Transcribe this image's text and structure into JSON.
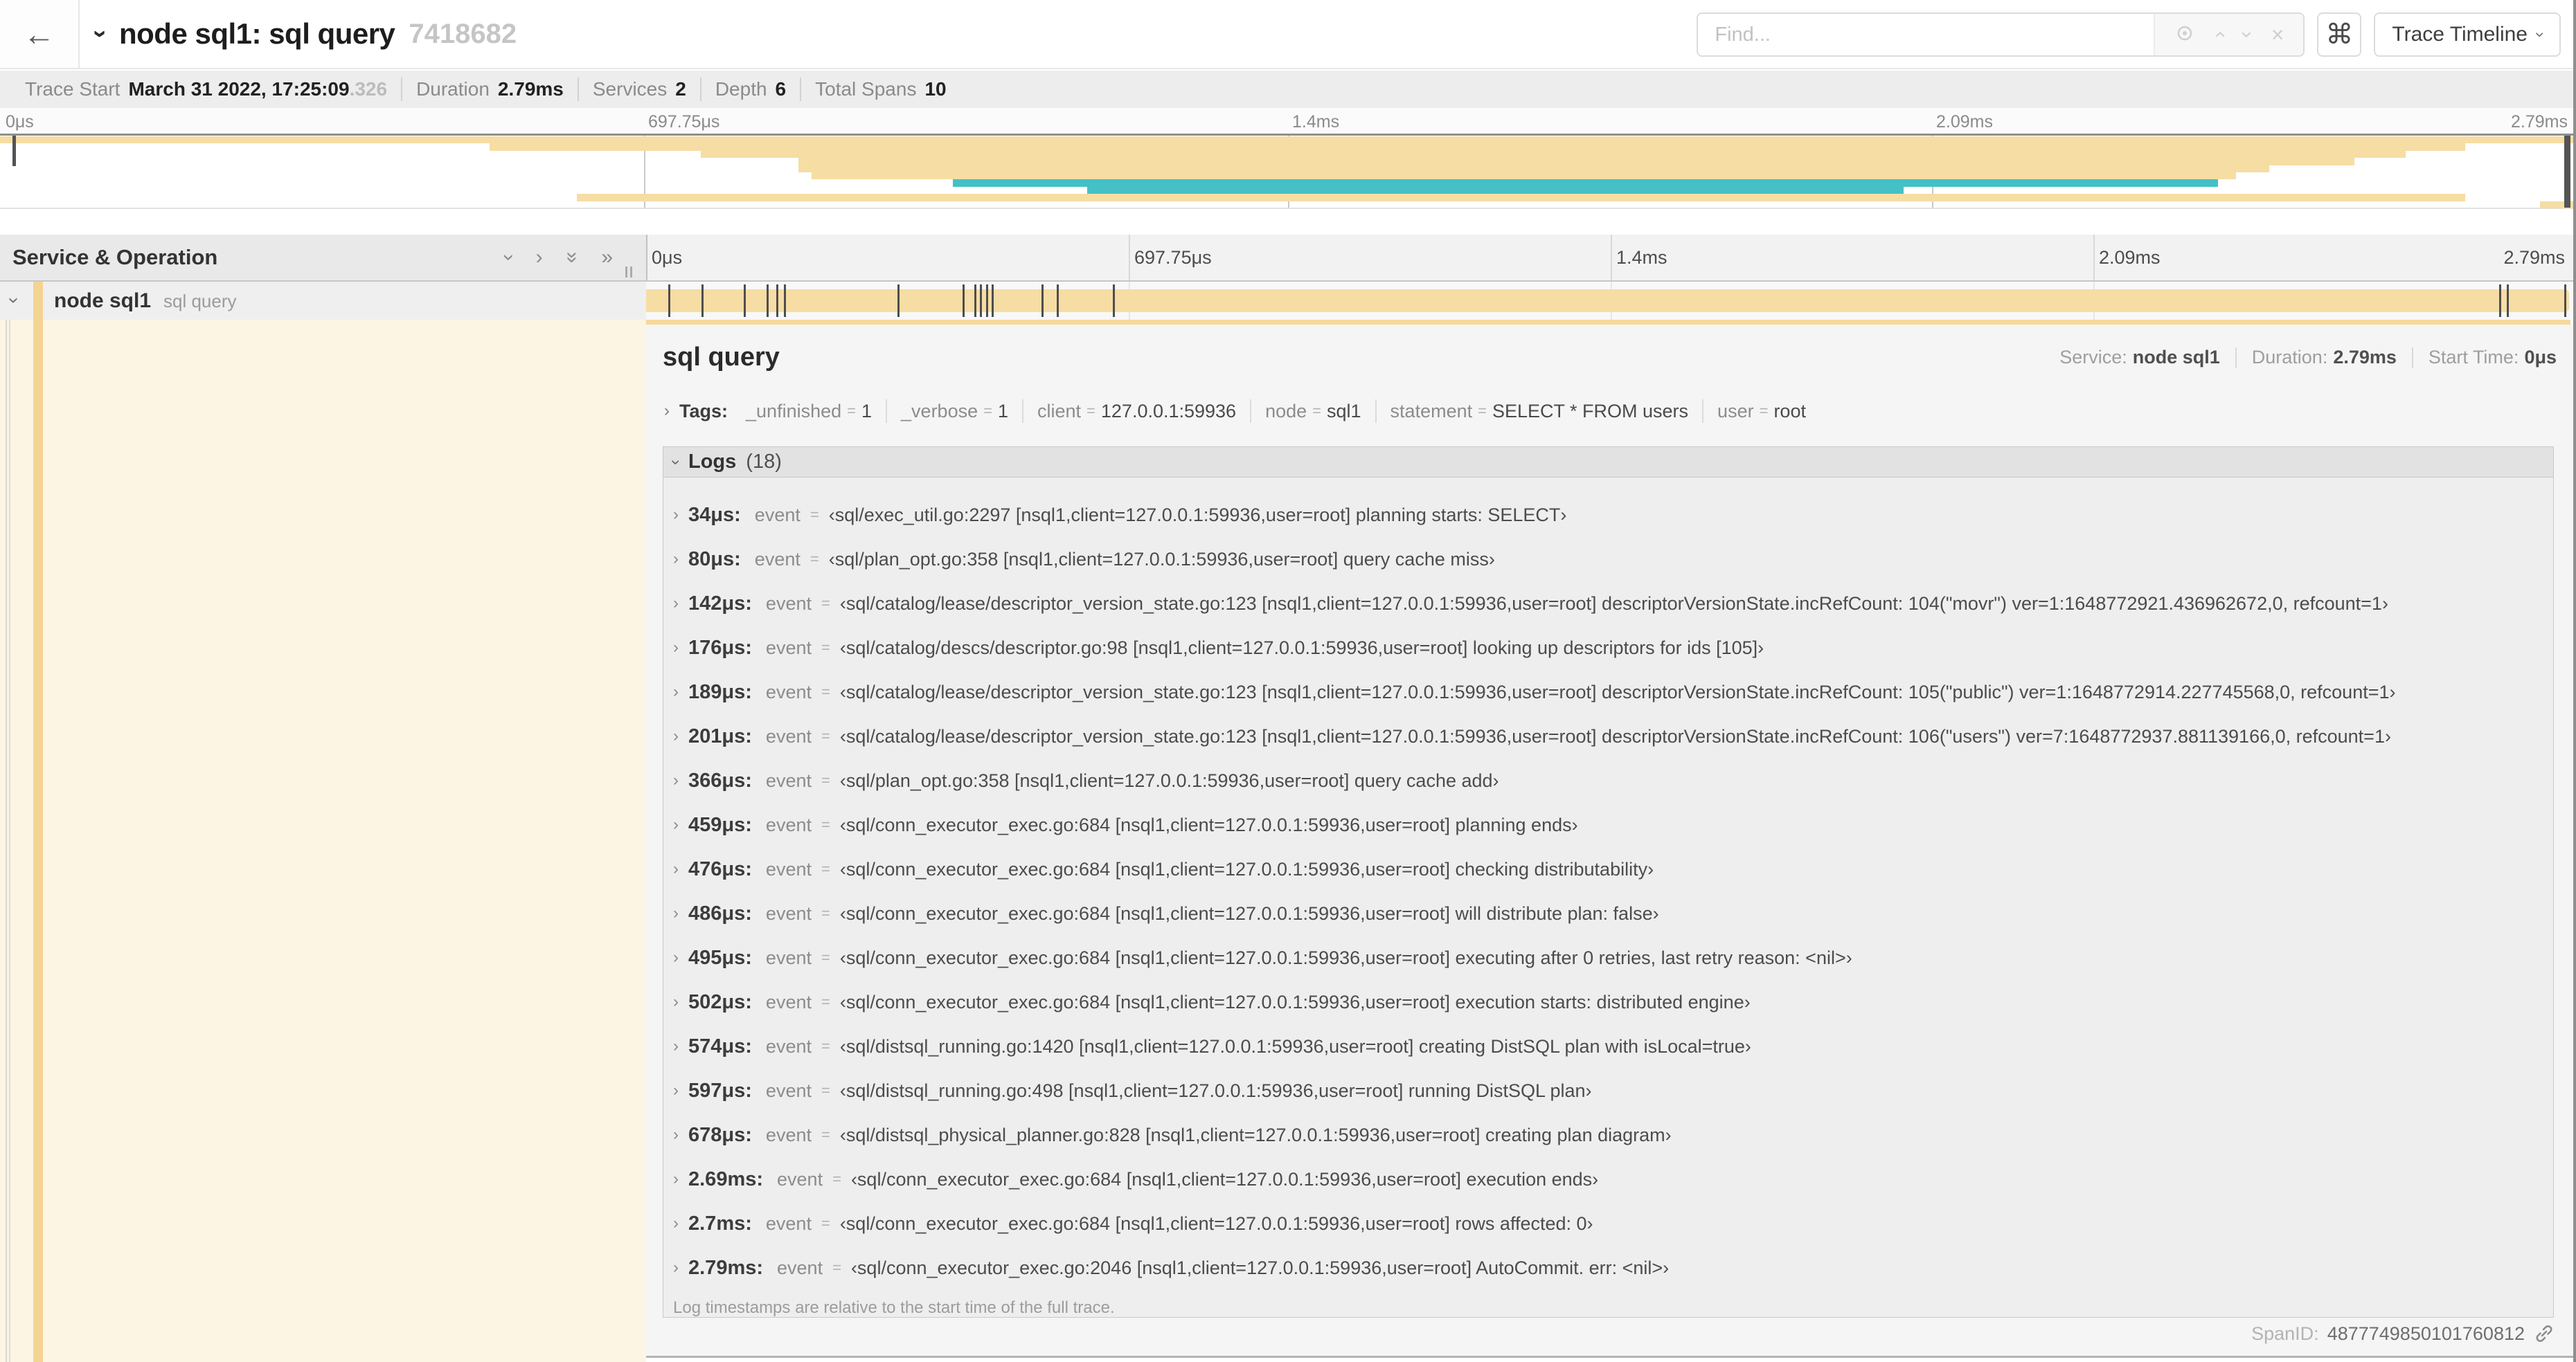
{
  "icons": {
    "back": "←",
    "chevron": "›",
    "double_chevron": "»",
    "command": "⌘",
    "close": "×"
  },
  "header": {
    "title": "node sql1: sql query",
    "trace_id": "7418682",
    "find_placeholder": "Find...",
    "view_dropdown_label": "Trace Timeline"
  },
  "trace_info": {
    "items": [
      {
        "label": "Trace Start",
        "value": "March 31 2022, 17:25:09",
        "suffix": ".326"
      },
      {
        "label": "Duration",
        "value": "2.79ms"
      },
      {
        "label": "Services",
        "value": "2"
      },
      {
        "label": "Depth",
        "value": "6"
      },
      {
        "label": "Total Spans",
        "value": "10"
      }
    ]
  },
  "timeline": {
    "ticks": [
      "0μs",
      "697.75μs",
      "1.4ms",
      "2.09ms",
      "2.79ms"
    ],
    "duration": "2.79ms"
  },
  "columns": {
    "left_header": "Service & Operation"
  },
  "minimap": {
    "spans": [
      {
        "row": 1,
        "start": 0,
        "end": 100,
        "color": "tan"
      },
      {
        "row": 2,
        "start": 19,
        "end": 95.7,
        "color": "tan"
      },
      {
        "row": 3,
        "start": 27.2,
        "end": 93.4,
        "color": "tan"
      },
      {
        "row": 4,
        "start": 31,
        "end": 91.4,
        "color": "tan"
      },
      {
        "row": 5,
        "start": 31,
        "end": 88.1,
        "color": "tan"
      },
      {
        "row": 6,
        "start": 31.5,
        "end": 86.8,
        "color": "tan"
      },
      {
        "row": 7,
        "start": 37,
        "end": 86.1,
        "color": "teal"
      },
      {
        "row": 8,
        "start": 42.2,
        "end": 73.9,
        "color": "teal"
      },
      {
        "row": 9,
        "start": 22.4,
        "end": 95.7,
        "color": "tan"
      },
      {
        "row": 10,
        "start": 98.6,
        "end": 100,
        "color": "tan"
      }
    ]
  },
  "span_row": {
    "service": "node sql1",
    "operation": "sql query",
    "tick_fractions": [
      1.2,
      2.9,
      5.1,
      6.3,
      6.8,
      7.2,
      13.1,
      16.5,
      17.1,
      17.4,
      17.7,
      18,
      20.6,
      21.4,
      24.3,
      96.4,
      96.8,
      99.8
    ]
  },
  "detail": {
    "operation": "sql query",
    "service_label": "Service:",
    "service": "node sql1",
    "duration_label": "Duration:",
    "duration": "2.79ms",
    "start_label": "Start Time:",
    "start": "0μs",
    "tags_label": "Tags:",
    "tags": [
      {
        "key": "_unfinished",
        "value": "1"
      },
      {
        "key": "_verbose",
        "value": "1"
      },
      {
        "key": "client",
        "value": "127.0.0.1:59936"
      },
      {
        "key": "node",
        "value": "sql1"
      },
      {
        "key": "statement",
        "value": "SELECT * FROM users"
      },
      {
        "key": "user",
        "value": "root"
      }
    ],
    "logs": {
      "label": "Logs",
      "count": "(18)",
      "entries": [
        {
          "ts": "34μs:",
          "key": "event",
          "value": "‹sql/exec_util.go:2297 [nsql1,client=127.0.0.1:59936,user=root] planning starts: SELECT›"
        },
        {
          "ts": "80μs:",
          "key": "event",
          "value": "‹sql/plan_opt.go:358 [nsql1,client=127.0.0.1:59936,user=root] query cache miss›"
        },
        {
          "ts": "142μs:",
          "key": "event",
          "value": "‹sql/catalog/lease/descriptor_version_state.go:123 [nsql1,client=127.0.0.1:59936,user=root] descriptorVersionState.incRefCount: 104(\"movr\") ver=1:1648772921.436962672,0, refcount=1›"
        },
        {
          "ts": "176μs:",
          "key": "event",
          "value": "‹sql/catalog/descs/descriptor.go:98 [nsql1,client=127.0.0.1:59936,user=root] looking up descriptors for ids [105]›"
        },
        {
          "ts": "189μs:",
          "key": "event",
          "value": "‹sql/catalog/lease/descriptor_version_state.go:123 [nsql1,client=127.0.0.1:59936,user=root] descriptorVersionState.incRefCount: 105(\"public\") ver=1:1648772914.227745568,0, refcount=1›"
        },
        {
          "ts": "201μs:",
          "key": "event",
          "value": "‹sql/catalog/lease/descriptor_version_state.go:123 [nsql1,client=127.0.0.1:59936,user=root] descriptorVersionState.incRefCount: 106(\"users\") ver=7:1648772937.881139166,0, refcount=1›"
        },
        {
          "ts": "366μs:",
          "key": "event",
          "value": "‹sql/plan_opt.go:358 [nsql1,client=127.0.0.1:59936,user=root] query cache add›"
        },
        {
          "ts": "459μs:",
          "key": "event",
          "value": "‹sql/conn_executor_exec.go:684 [nsql1,client=127.0.0.1:59936,user=root] planning ends›"
        },
        {
          "ts": "476μs:",
          "key": "event",
          "value": "‹sql/conn_executor_exec.go:684 [nsql1,client=127.0.0.1:59936,user=root] checking distributability›"
        },
        {
          "ts": "486μs:",
          "key": "event",
          "value": "‹sql/conn_executor_exec.go:684 [nsql1,client=127.0.0.1:59936,user=root] will distribute plan: false›"
        },
        {
          "ts": "495μs:",
          "key": "event",
          "value": "‹sql/conn_executor_exec.go:684 [nsql1,client=127.0.0.1:59936,user=root] executing after 0 retries, last retry reason: <nil>›"
        },
        {
          "ts": "502μs:",
          "key": "event",
          "value": "‹sql/conn_executor_exec.go:684 [nsql1,client=127.0.0.1:59936,user=root] execution starts: distributed engine›"
        },
        {
          "ts": "574μs:",
          "key": "event",
          "value": "‹sql/distsql_running.go:1420 [nsql1,client=127.0.0.1:59936,user=root] creating DistSQL plan with isLocal=true›"
        },
        {
          "ts": "597μs:",
          "key": "event",
          "value": "‹sql/distsql_running.go:498 [nsql1,client=127.0.0.1:59936,user=root] running DistSQL plan›"
        },
        {
          "ts": "678μs:",
          "key": "event",
          "value": "‹sql/distsql_physical_planner.go:828 [nsql1,client=127.0.0.1:59936,user=root] creating plan diagram›"
        },
        {
          "ts": "2.69ms:",
          "key": "event",
          "value": "‹sql/conn_executor_exec.go:684 [nsql1,client=127.0.0.1:59936,user=root] execution ends›"
        },
        {
          "ts": "2.7ms:",
          "key": "event",
          "value": "‹sql/conn_executor_exec.go:684 [nsql1,client=127.0.0.1:59936,user=root] rows affected: 0›"
        },
        {
          "ts": "2.79ms:",
          "key": "event",
          "value": "‹sql/conn_executor_exec.go:2046 [nsql1,client=127.0.0.1:59936,user=root] AutoCommit. err: <nil>›"
        }
      ],
      "footnote": "Log timestamps are relative to the start time of the full trace."
    },
    "span_id_label": "SpanID:",
    "span_id": "4877749850101760812"
  },
  "colors": {
    "span_tan": "#F6DDA4",
    "span_teal": "#44C0C6",
    "accent": "#F4D493",
    "left_column_bg": "#FCF5E3"
  }
}
